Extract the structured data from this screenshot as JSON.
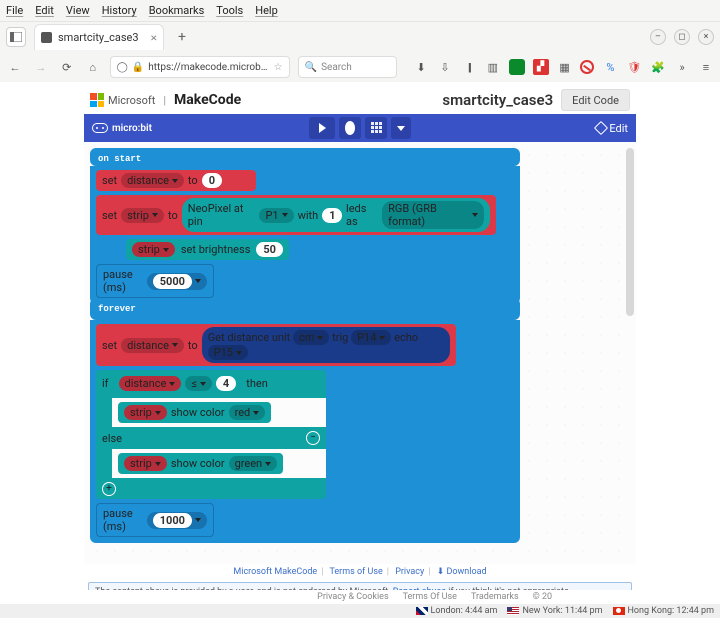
{
  "menubar": {
    "items": [
      "File",
      "Edit",
      "View",
      "History",
      "Bookmarks",
      "Tools",
      "Help"
    ]
  },
  "tab": {
    "title": "smartcity_case3"
  },
  "url": {
    "host": "https://makecode.microbit.org",
    "search_placeholder": "Search"
  },
  "header": {
    "ms": "Microsoft",
    "makecode": "MakeCode",
    "project": "smartcity_case3",
    "edit_code": "Edit Code",
    "microbit": "micro:bit",
    "edit": "Edit"
  },
  "blocks": {
    "on_start": "on start",
    "set": "set",
    "distance": "distance",
    "strip": "strip",
    "to": "to",
    "zero": "0",
    "neopixel": "NeoPixel at pin",
    "pin_p1": "P1",
    "with": "with",
    "one": "1",
    "leds_as": "leds as",
    "rgb_fmt": "RGB (GRB format)",
    "set_brightness": "set brightness",
    "fifty": "50",
    "pause": "pause (ms)",
    "five_thousand": "5000",
    "forever": "forever",
    "get_distance": "Get distance unit",
    "cm": "cm",
    "trig": "trig",
    "p14": "P14",
    "echo": "echo",
    "p15": "P15",
    "if": "if",
    "le": "≤",
    "four": "4",
    "then": "then",
    "show_color": "show color",
    "red": "red",
    "else": "else",
    "green": "green",
    "one_thousand": "1000"
  },
  "footer": {
    "links": {
      "makecode": "Microsoft MakeCode",
      "terms": "Terms of Use",
      "privacy": "Privacy",
      "download": "Download"
    },
    "msg_pre": "The content above is provided by a user, and is not endorsed by Microsoft. ",
    "msg_link": "Report abuse",
    "msg_post": " if you think it's not appropriate.",
    "privacy": "Privacy & Cookies",
    "tou": "Terms Of Use",
    "tm": "Trademarks",
    "copyright": "© 20"
  },
  "status": {
    "london": "London: 4:44 am",
    "newyork": "New York: 11:44 pm",
    "hongkong": "Hong Kong: 12:44 pm"
  }
}
